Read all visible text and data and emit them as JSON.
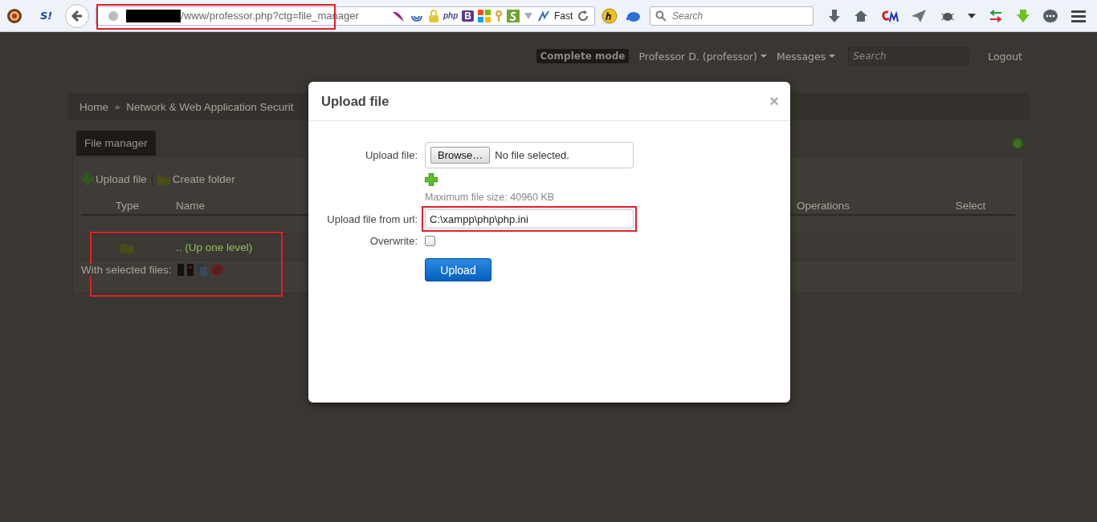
{
  "browser": {
    "badge": "S!",
    "address": "/www/professor.php?ctg=file_manager",
    "extension_labels": [
      "php",
      "B"
    ],
    "speed_label": "Fast",
    "search": {
      "placeholder": "Search"
    }
  },
  "nav": {
    "mode_badge": "Complete mode",
    "user_menu": "Professor D. (professor)",
    "messages_menu": "Messages",
    "search": {
      "placeholder": "Search"
    },
    "logout": "Logout"
  },
  "breadcrumb": {
    "items": [
      "Home",
      "Network & Web Application Securit"
    ],
    "separator": "»"
  },
  "tabs": [
    {
      "label": "File manager",
      "selected": true
    }
  ],
  "toolbar": [
    {
      "kind": "upload",
      "label": "Upload file"
    },
    {
      "kind": "folder",
      "label": "Create folder"
    }
  ],
  "table": {
    "columns": [
      "Type",
      "Name",
      "Operations",
      "Select"
    ],
    "rows": [
      {
        "kind": "parent",
        "name": ".. (Up one level)"
      }
    ]
  },
  "with_selected_label": "With selected files:",
  "modal": {
    "title": "Upload file",
    "close": "×",
    "fields": [
      {
        "kind": "file",
        "label": "Upload file:",
        "button": "Browse…",
        "status": "No file selected."
      },
      {
        "kind": "note",
        "text": "Maximum file size: 40960 KB"
      },
      {
        "kind": "text",
        "label": "Upload file from url:",
        "value": "C:\\xampp\\php\\php.ini"
      },
      {
        "kind": "checkbox",
        "label": "Overwrite:",
        "checked": false
      }
    ],
    "submit": "Upload"
  }
}
